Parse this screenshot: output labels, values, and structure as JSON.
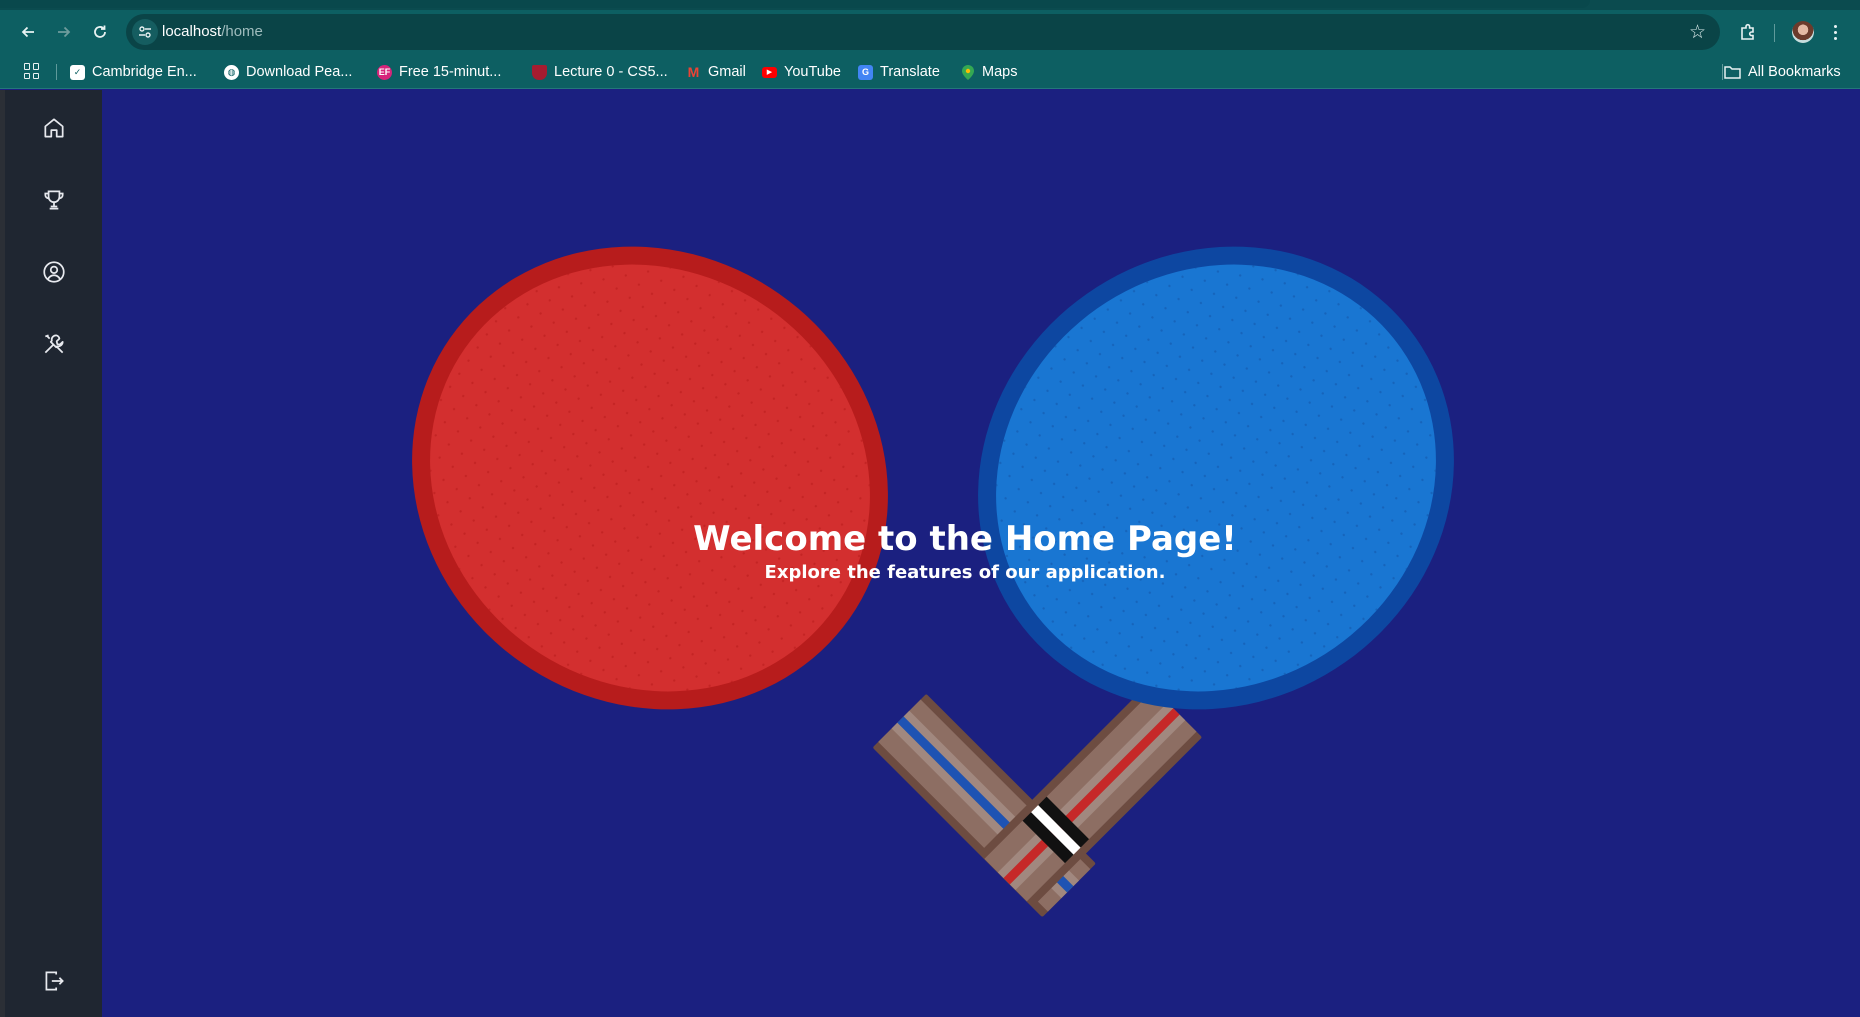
{
  "browser": {
    "url_host": "localhost",
    "url_path": "/home",
    "bookmarks": [
      {
        "label": "Cambridge En...",
        "icon": "checkbox-icon",
        "color": "#ffffff"
      },
      {
        "label": "Download Pea...",
        "icon": "globe-icon",
        "color": "#ffffff"
      },
      {
        "label": "Free 15-minut...",
        "icon": "ef-logo-icon",
        "color": "#d6247a"
      },
      {
        "label": "Lecture 0 - CS5...",
        "icon": "harvard-shield-icon",
        "color": "#a51c30"
      },
      {
        "label": "Gmail",
        "icon": "gmail-icon",
        "color": "#ea4335"
      },
      {
        "label": "YouTube",
        "icon": "youtube-icon",
        "color": "#ff0000"
      },
      {
        "label": "Translate",
        "icon": "translate-icon",
        "color": "#4285f4"
      },
      {
        "label": "Maps",
        "icon": "maps-pin-icon",
        "color": "#34a853"
      }
    ],
    "all_bookmarks_label": "All Bookmarks"
  },
  "sidebar": {
    "items": [
      {
        "name": "home",
        "icon": "home-icon"
      },
      {
        "name": "trophy",
        "icon": "trophy-icon"
      },
      {
        "name": "profile",
        "icon": "user-circle-icon"
      },
      {
        "name": "settings",
        "icon": "tools-icon"
      }
    ],
    "logout_icon": "logout-icon"
  },
  "hero": {
    "title": "Welcome to the Home Page!",
    "subtitle": "Explore the features of our application."
  },
  "colors": {
    "background": "#1b2080",
    "sidebar": "#1f2631",
    "chrome": "#0d5f62",
    "paddle_red": "#d32f2f",
    "paddle_blue": "#1976d2"
  }
}
